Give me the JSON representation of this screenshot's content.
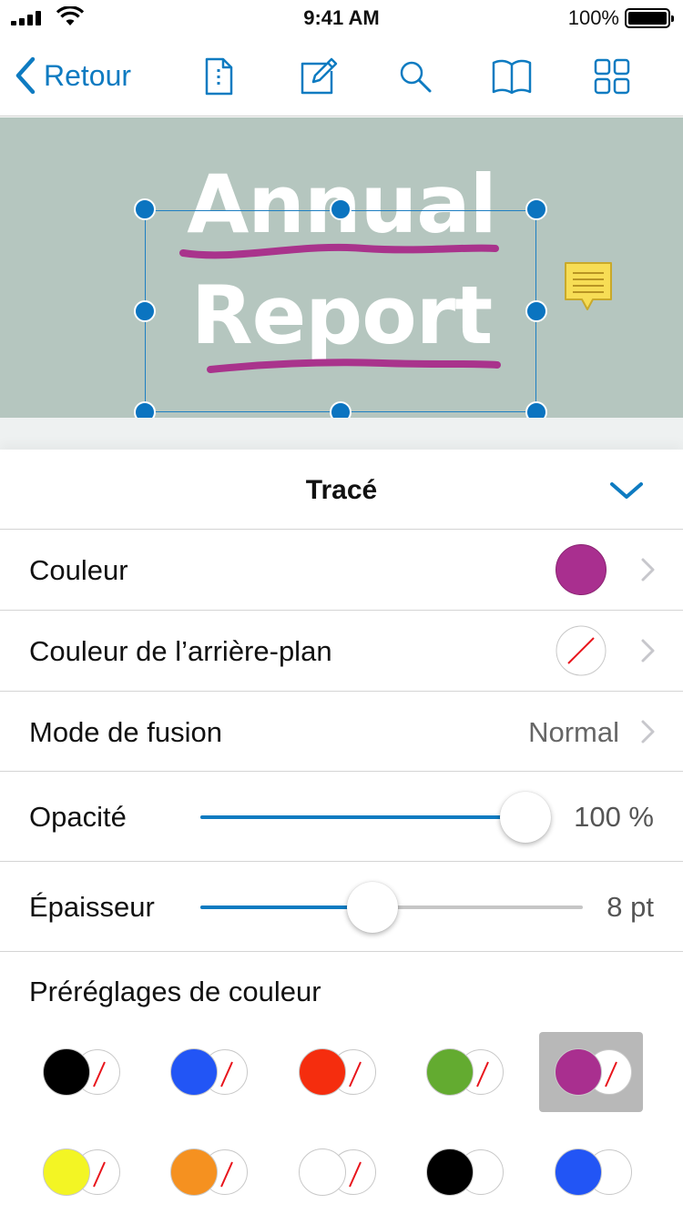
{
  "status_bar": {
    "time": "9:41 AM",
    "battery_percent": "100%"
  },
  "nav": {
    "back_label": "Retour",
    "icons": [
      "document-info-icon",
      "edit-annotation-icon",
      "search-icon",
      "book-outline-icon",
      "thumbnail-grid-icon"
    ]
  },
  "document": {
    "title_line1": "Annual",
    "title_line2": "Report",
    "background_color": "#b5c6bf",
    "ink_color": "#a9338c"
  },
  "panel": {
    "title": "Tracé",
    "rows": {
      "color": {
        "label": "Couleur",
        "value_color": "#a92f8f"
      },
      "fill_color": {
        "label": "Couleur de l’arrière-plan",
        "value": "none"
      },
      "blend_mode": {
        "label": "Mode de fusion",
        "value": "Normal"
      },
      "opacity": {
        "label": "Opacité",
        "value": "100 %",
        "fraction": 1.0
      },
      "thickness": {
        "label": "Épaisseur",
        "value": "8 pt",
        "fraction": 0.45
      }
    },
    "presets_label": "Préréglages de couleur",
    "accent_color": "#0e7bc1",
    "presets": [
      {
        "stroke": "#000000",
        "fill": "none",
        "selected": false
      },
      {
        "stroke": "#2255f5",
        "fill": "none",
        "selected": false
      },
      {
        "stroke": "#f52d0e",
        "fill": "none",
        "selected": false
      },
      {
        "stroke": "#63ab30",
        "fill": "none",
        "selected": false
      },
      {
        "stroke": "#a92f8f",
        "fill": "none",
        "selected": true
      },
      {
        "stroke": "#f3f524",
        "fill": "none",
        "selected": false
      },
      {
        "stroke": "#f59120",
        "fill": "none",
        "selected": false
      },
      {
        "stroke": "#ffffff",
        "fill": "none",
        "selected": false
      },
      {
        "stroke": "#000000",
        "fill": "#ffffff",
        "selected": false
      },
      {
        "stroke": "#2255f5",
        "fill": "#ffffff",
        "selected": false
      }
    ]
  }
}
